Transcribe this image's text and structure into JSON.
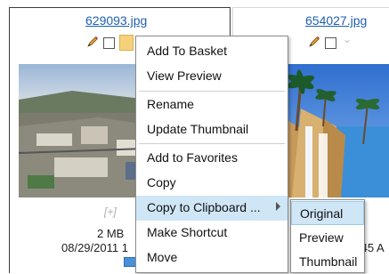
{
  "cards": [
    {
      "filename": "629093.jpg",
      "plus": "[+]",
      "size": "2 MB",
      "date": "08/29/2011 1"
    },
    {
      "filename": "654027.jpg",
      "time_fragment": ":45 A"
    }
  ],
  "context_menu": {
    "items": [
      {
        "label": "Add To Basket"
      },
      {
        "label": "View Preview"
      },
      {
        "label": "Rename"
      },
      {
        "label": "Update Thumbnail"
      },
      {
        "label": "Add to Favorites"
      },
      {
        "label": "Copy"
      },
      {
        "label": "Copy to Clipboard ..."
      },
      {
        "label": "Make Shortcut"
      },
      {
        "label": "Move"
      }
    ]
  },
  "clipboard_submenu": {
    "items": [
      {
        "label": "Original"
      },
      {
        "label": "Preview"
      },
      {
        "label": "Thumbnail"
      }
    ]
  },
  "colors": {
    "link": "#1f5fb0",
    "menu_highlight": "#cfe6f6",
    "selected_card_border": "#3c3c3c"
  },
  "icons": {
    "edit": "pencil-icon",
    "select": "checkbox",
    "menu_toggle": "chevron-down-icon",
    "submenu": "caret-right-icon",
    "file_type": "image-file-icon"
  }
}
